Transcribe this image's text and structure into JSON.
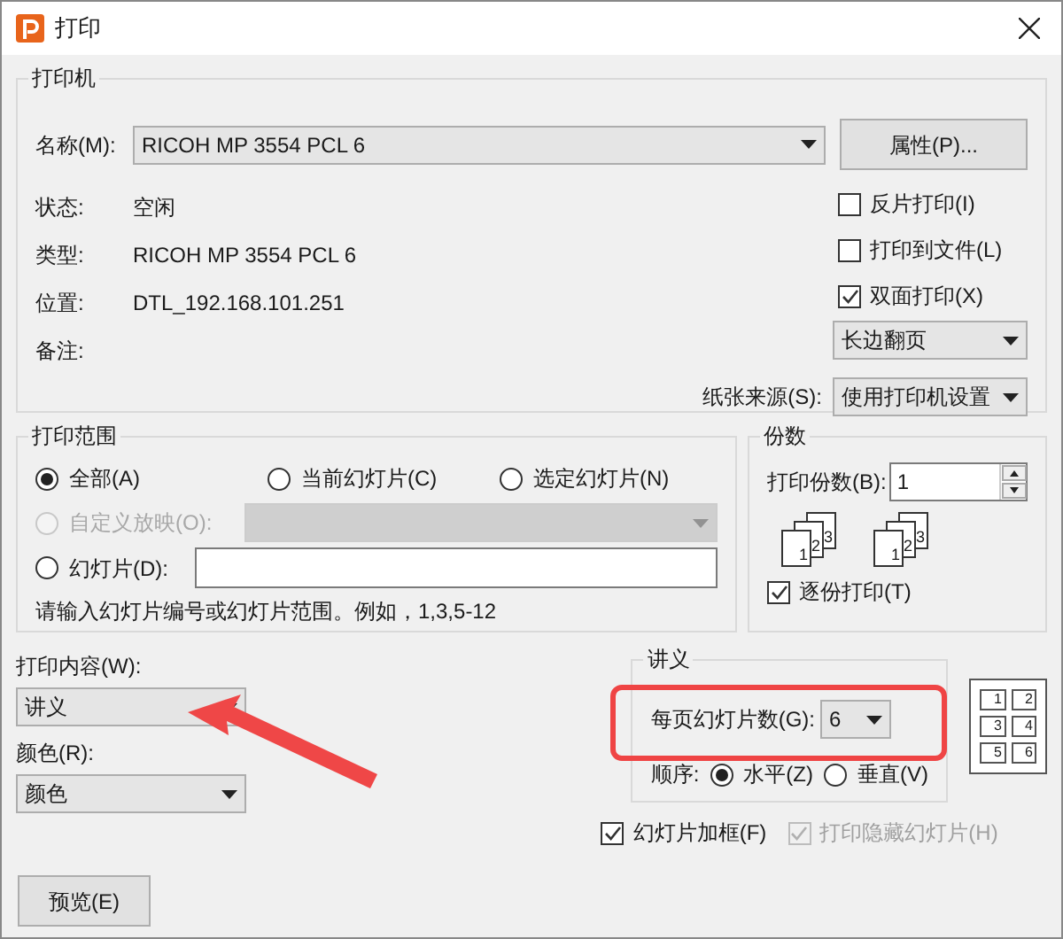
{
  "window": {
    "title": "打印"
  },
  "printer": {
    "group_title": "打印机",
    "name_label": "名称(M):",
    "name_value": "RICOH MP 3554 PCL 6",
    "properties_button": "属性(P)...",
    "info": [
      {
        "label": "状态:",
        "value": "空闲"
      },
      {
        "label": "类型:",
        "value": "RICOH MP 3554 PCL 6"
      },
      {
        "label": "位置:",
        "value": "DTL_192.168.101.251"
      },
      {
        "label": "备注:"
      }
    ],
    "options": [
      {
        "label": "反片打印(I)",
        "checked": false
      },
      {
        "label": "打印到文件(L)",
        "checked": false
      },
      {
        "label": "双面打印(X)",
        "checked": true
      }
    ],
    "duplex_value": "长边翻页",
    "paper_source_label": "纸张来源(S):",
    "paper_source_value": "使用打印机设置"
  },
  "print_range": {
    "group_title": "打印范围",
    "options": [
      {
        "label": "全部(A)",
        "selected": true,
        "disabled": false
      },
      {
        "label": "当前幻灯片(C)",
        "selected": false,
        "disabled": false
      },
      {
        "label": "选定幻灯片(N)",
        "selected": false,
        "disabled": false
      },
      {
        "label": "自定义放映(O):",
        "selected": false,
        "disabled": true
      },
      {
        "label": "幻灯片(D):",
        "selected": false,
        "disabled": false
      }
    ],
    "hint": "请输入幻灯片编号或幻灯片范围。例如，1,3,5-12"
  },
  "copies": {
    "group_title": "份数",
    "label": "打印份数(B):",
    "value": "1",
    "collate_stacks": [
      [
        "1",
        "2",
        "3"
      ],
      [
        "1",
        "2",
        "3"
      ]
    ],
    "collate": {
      "label": "逐份打印(T)",
      "checked": true
    }
  },
  "print_what": {
    "label": "打印内容(W):",
    "value": "讲义"
  },
  "color": {
    "label": "颜色(R):",
    "value": "颜色"
  },
  "handouts": {
    "group_title": "讲义",
    "per_page_label": "每页幻灯片数(G):",
    "per_page_value": "6",
    "order_label": "顺序:",
    "order_options": [
      {
        "label": "水平(Z)",
        "selected": true
      },
      {
        "label": "垂直(V)",
        "selected": false
      }
    ],
    "layout_numbers": [
      "1",
      "2",
      "3",
      "4",
      "5",
      "6"
    ]
  },
  "frame_slides": {
    "label": "幻灯片加框(F)",
    "checked": true,
    "disabled": false
  },
  "print_hidden": {
    "label": "打印隐藏幻灯片(H)",
    "checked": true,
    "disabled": true
  },
  "preview_button": "预览(E)"
}
